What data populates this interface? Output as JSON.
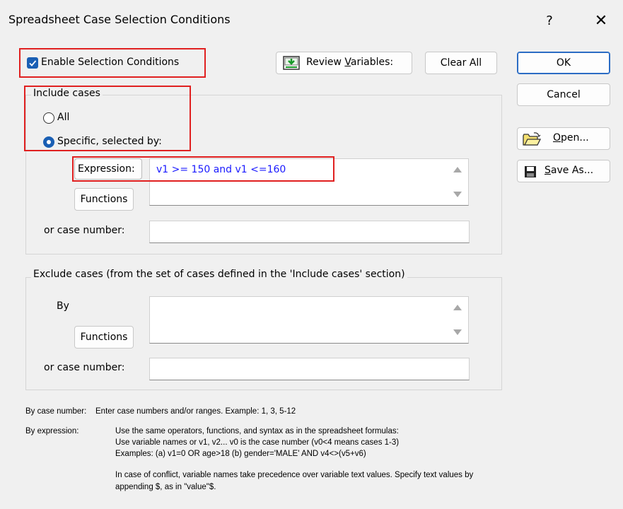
{
  "window": {
    "title": "Spreadsheet Case Selection Conditions",
    "help_label": "?",
    "close_label": "✕"
  },
  "top": {
    "enable_label": "Enable Selection Conditions",
    "enable_checked": true,
    "review_label_pre": "Review ",
    "review_label_u": "V",
    "review_label_post": "ariables:",
    "clear_all_label": "Clear All"
  },
  "side": {
    "ok_label": "OK",
    "cancel_label": "Cancel",
    "open_u": "O",
    "open_rest": "pen...",
    "saveas_u": "S",
    "saveas_rest": "ave As..."
  },
  "include": {
    "legend": "Include cases",
    "all_label": "All",
    "specific_label": "Specific, selected by:",
    "selected": "specific",
    "expression_label": "Expression:",
    "expression_value": "v1 >= 150 and v1 <=160",
    "functions_label": "Functions",
    "case_number_label": "or case number:",
    "case_number_value": ""
  },
  "exclude": {
    "legend": "Exclude cases (from the set of cases defined in the 'Include cases' section)",
    "by_label": "By",
    "by_value": "",
    "functions_label": "Functions",
    "case_number_label": "or case number:",
    "case_number_value": ""
  },
  "help": {
    "case_number_key": "By case number:",
    "case_number_text": "Enter case numbers and/or ranges.  Example:  1, 3, 5-12",
    "expression_key": "By expression:",
    "expression_line1": "Use the same operators, functions, and syntax as in the spreadsheet formulas:",
    "expression_line2": "Use variable names or v1, v2...   v0 is the case number  (v0<4 means cases 1-3)",
    "expression_line3": "Examples:  (a) v1=0 OR age>18  (b) gender='MALE' AND v4<>(v5+v6)",
    "conflict_line1": "In case of conflict, variable names take precedence over variable text values. Specify text values by",
    "conflict_line2": "appending $, as in \"value\"$."
  },
  "colors": {
    "highlight": "#e02020",
    "accent": "#1a5fb4",
    "expression_text": "#1a1aff"
  }
}
